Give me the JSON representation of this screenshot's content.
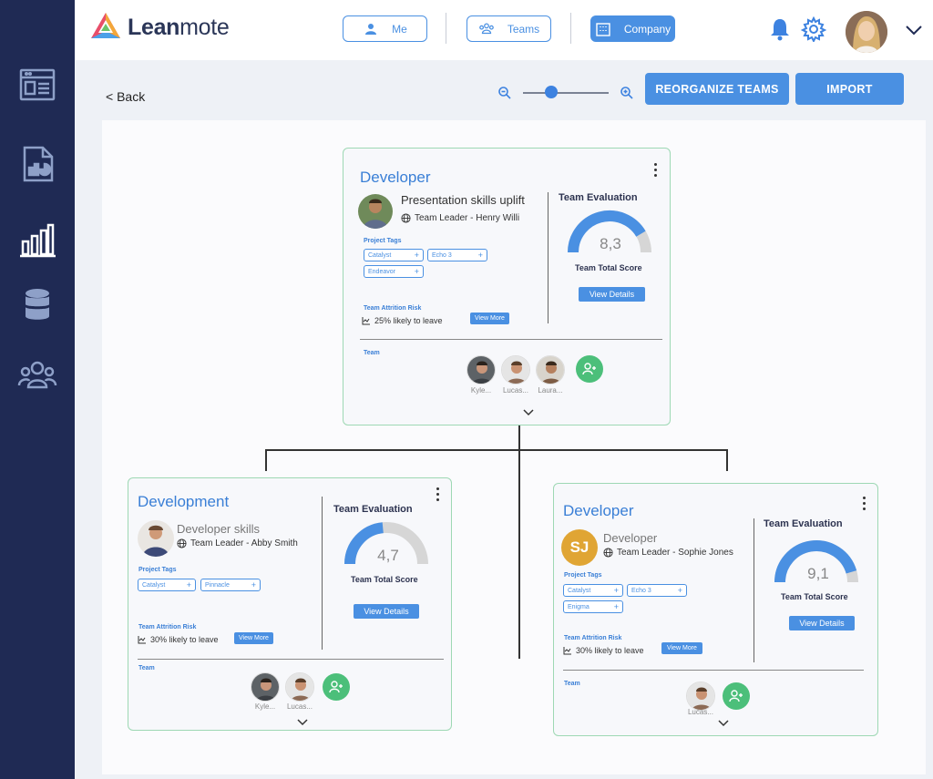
{
  "brand": {
    "name_bold": "Lean",
    "name_thin": "mote"
  },
  "nav": {
    "me": "Me",
    "teams": "Teams",
    "company": "Company"
  },
  "sidebar": {
    "items": [
      {
        "icon": "dashboard-icon"
      },
      {
        "icon": "report-icon"
      },
      {
        "icon": "bar-chart-icon"
      },
      {
        "icon": "database-icon"
      },
      {
        "icon": "people-icon"
      }
    ]
  },
  "toolbar": {
    "back": "< Back",
    "reorganize": "REORGANIZE TEAMS",
    "import": "IMPORT",
    "zoom_level": 0.25
  },
  "colors": {
    "accent": "#4a90e2",
    "sidebar": "#1f2a54",
    "card_border": "#9ed8b4",
    "add_member": "#4cbf7a",
    "gauge_track": "#d6d6d6"
  },
  "cards": {
    "top": {
      "title": "Developer",
      "course": "Presentation skills uplift",
      "leader": "Team Leader - Henry Willi",
      "tags_label": "Project Tags",
      "tags": [
        "Catalyst",
        "Echo 3",
        "Endeavor"
      ],
      "attrition_label": "Team Attrition Risk",
      "attrition": "25% likely to leave",
      "view_more": "View More",
      "eval_title": "Team Evaluation",
      "score": "8,3",
      "score_value": 8.3,
      "total_label": "Team Total Score",
      "view_details": "View Details",
      "team_label": "Team",
      "members": [
        "Kyle...",
        "Lucas...",
        "Laura..."
      ]
    },
    "left": {
      "title": "Development",
      "course": "Developer skills",
      "leader": "Team Leader - Abby Smith",
      "tags_label": "Project Tags",
      "tags": [
        "Catalyst",
        "Pinnacle"
      ],
      "attrition_label": "Team Attrition Risk",
      "attrition": "30% likely to leave",
      "view_more": "View More",
      "eval_title": "Team Evaluation",
      "score": "4,7",
      "score_value": 4.7,
      "total_label": "Team Total Score",
      "view_details": "View Details",
      "team_label": "Team",
      "members": [
        "Kyle...",
        "Lucas..."
      ]
    },
    "right": {
      "title": "Developer",
      "initials": "SJ",
      "course": "Developer",
      "leader": "Team Leader - Sophie Jones",
      "tags_label": "Project Tags",
      "tags": [
        "Catalyst",
        "Echo 3",
        "Enigma"
      ],
      "attrition_label": "Team Attrition Risk",
      "attrition": "30% likely to leave",
      "view_more": "View More",
      "eval_title": "Team Evaluation",
      "score": "9,1",
      "score_value": 9.1,
      "total_label": "Team Total Score",
      "view_details": "View Details",
      "team_label": "Team",
      "members": [
        "Lucas..."
      ]
    }
  }
}
